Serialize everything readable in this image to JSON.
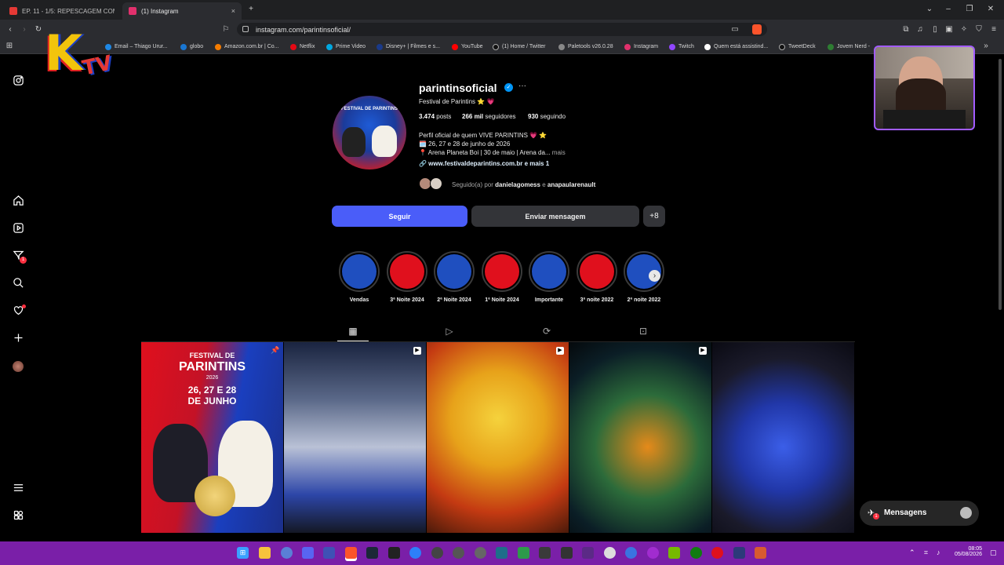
{
  "browser": {
    "tabs": [
      {
        "label": "EP. 11 - 1/5: REPESCAGEM COM",
        "color": "#e53935"
      },
      {
        "label": "(1) Instagram",
        "color": "#e1306c"
      }
    ],
    "new_tab": "+",
    "close_tab": "×",
    "url": "instagram.com/parintinsoficial/",
    "bookmarks": [
      {
        "label": "Email – Thiago Urur...",
        "color": "#1e88e5"
      },
      {
        "label": "globo",
        "color": "#1976d2"
      },
      {
        "label": "Amazon.com.br | Co...",
        "color": "#f57c00"
      },
      {
        "label": "Netflix",
        "color": "#e50914"
      },
      {
        "label": "Prime Video",
        "color": "#00a8e1"
      },
      {
        "label": "Disney+ | Filmes e s...",
        "color": "#1a3a8a"
      },
      {
        "label": "YouTube",
        "color": "#ff0000"
      },
      {
        "label": "(1) Home / Twitter",
        "color": "#111111"
      },
      {
        "label": "Paletools v26.0.28",
        "color": "#888888"
      },
      {
        "label": "Instagram",
        "color": "#e1306c"
      },
      {
        "label": "Twitch",
        "color": "#9146ff"
      },
      {
        "label": "Quem está assistind...",
        "color": "#222222"
      },
      {
        "label": "TweetDeck",
        "color": "#111111"
      },
      {
        "label": "Jovem Nerd - ",
        "color": "#2e7d32"
      }
    ]
  },
  "overlay": {
    "logo_k": "K",
    "logo_tv": "TV"
  },
  "profile": {
    "username": "parintinsoficial",
    "more": "···",
    "display_name": "Festival de Parintins ⭐ 💗",
    "posts_count": "3.474",
    "posts_label": "posts",
    "followers_count": "266 mil",
    "followers_label": "seguidores",
    "following_count": "930",
    "following_label": "seguindo",
    "bio_line1": "Perfil oficial de quem VIVE PARINTINS 💗 ⭐",
    "bio_line2": "🗓️ 26, 27 e 28 de junho de 2026",
    "bio_line3": "📍 Arena Planeta Boi | 30 de maio | Arena da...",
    "bio_more": "mais",
    "link": "🔗 www.festivaldeparintins.com.br e mais 1",
    "followed_by_prefix": "Seguido(a) por ",
    "followed_by_user1": "danielagomess",
    "followed_by_and": " e ",
    "followed_by_user2": "anapaularenault",
    "follow_button": "Seguir",
    "message_button": "Enviar mensagem",
    "add_user_button": "+8",
    "avatar_text": "FESTIVAL DE PARINTINS"
  },
  "highlights": [
    {
      "label": "Vendas",
      "color": "#1f4fbf"
    },
    {
      "label": "3ª Noite 2024",
      "color": "#e0101d"
    },
    {
      "label": "2ª Noite 2024",
      "color": "#1f4fbf"
    },
    {
      "label": "1ª Noite 2024",
      "color": "#e0101d"
    },
    {
      "label": "Importante",
      "color": "#1f4fbf"
    },
    {
      "label": "3ª noite 2022",
      "color": "#e0101d"
    },
    {
      "label": "2ª noite 2022",
      "color": "#1f4fbf"
    }
  ],
  "post1": {
    "l1": "FESTIVAL DE",
    "l2": "PARINTINS",
    "l3": "2026",
    "l4": "26, 27 E 28",
    "l5": "DE JUNHO"
  },
  "messages_button": "Mensagens",
  "messages_badge": "1",
  "nav_badge": "1",
  "taskbar": {
    "time": "08:05",
    "date": "05/08/2026"
  }
}
